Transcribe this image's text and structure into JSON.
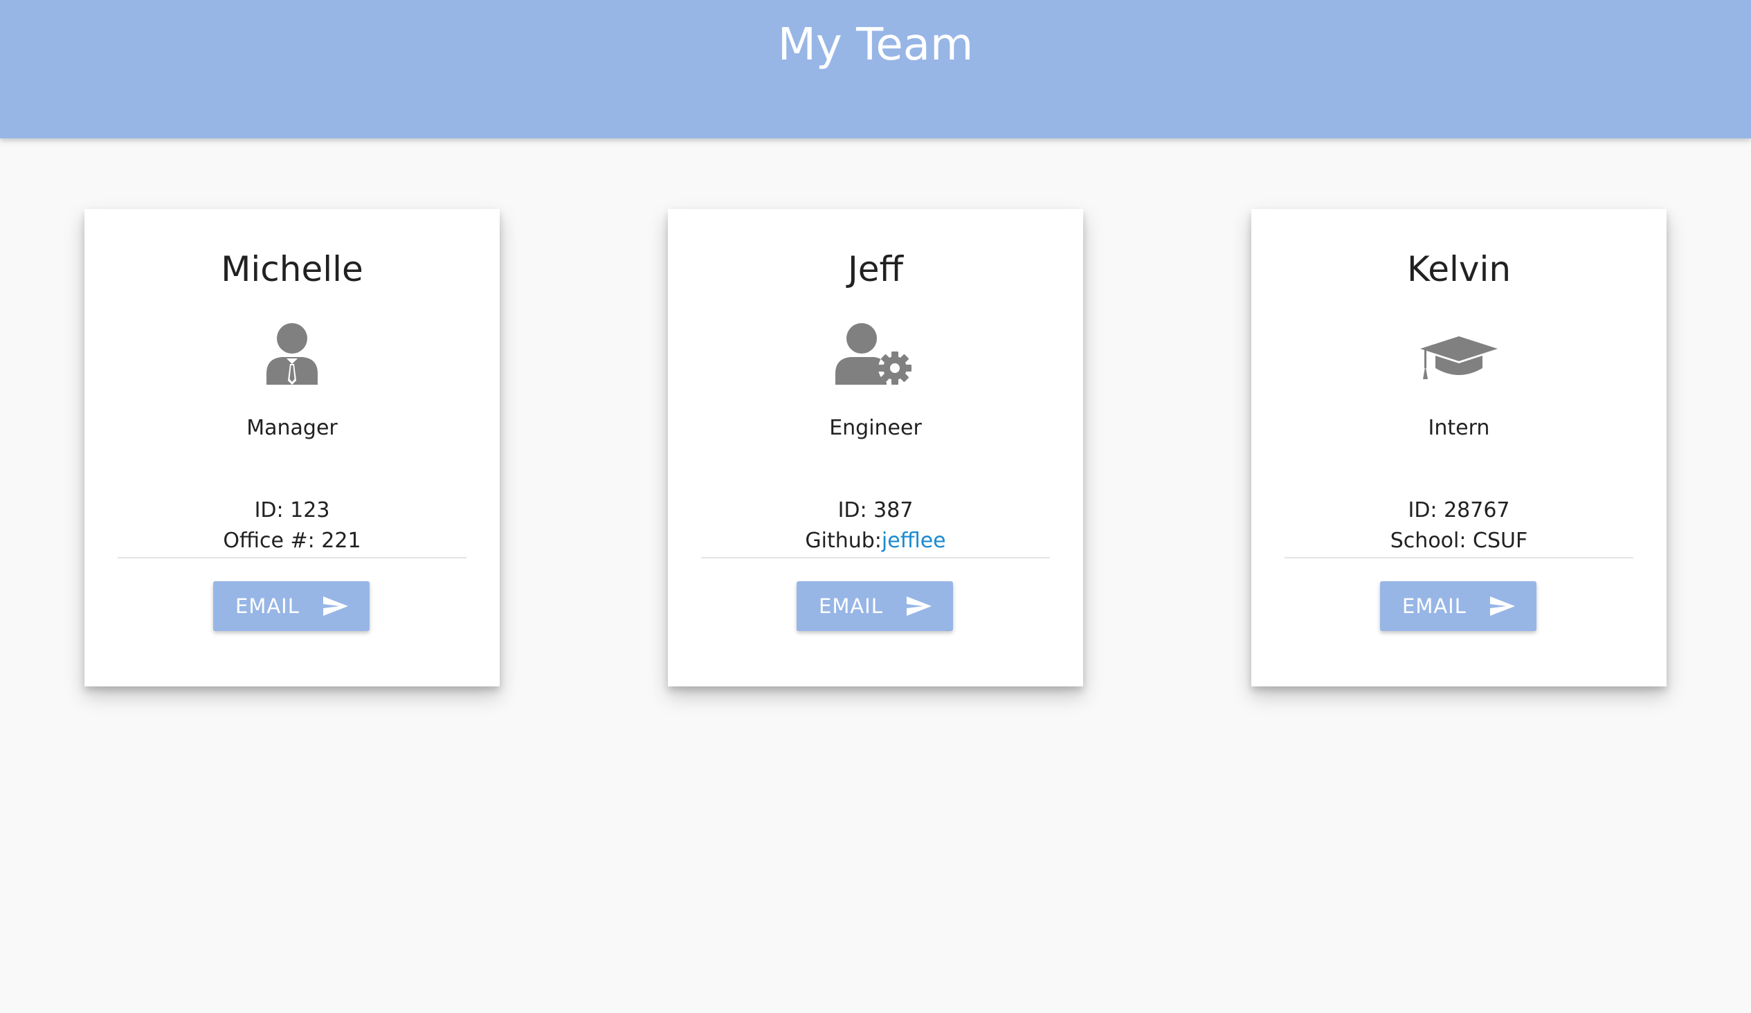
{
  "header": {
    "title": "My Team"
  },
  "colors": {
    "header_bg": "#97b6e6",
    "button_bg": "#97b6e6",
    "link": "#1a8ad1",
    "icon_gray": "#808080"
  },
  "team": [
    {
      "name": "Michelle",
      "role": "Manager",
      "role_icon": "manager-icon",
      "id_text": "ID: 123",
      "extra_text": "Office #: 221",
      "email_label": "EMAIL",
      "email_icon": "send-icon"
    },
    {
      "name": "Jeff",
      "role": "Engineer",
      "role_icon": "engineer-icon",
      "id_text": "ID: 387",
      "extra_prefix": "Github:",
      "extra_link": "jefflee",
      "email_label": "EMAIL",
      "email_icon": "send-icon"
    },
    {
      "name": "Kelvin",
      "role": "Intern",
      "role_icon": "graduation-cap-icon",
      "id_text": "ID: 28767",
      "extra_text": "School: CSUF",
      "email_label": "EMAIL",
      "email_icon": "send-icon"
    }
  ]
}
